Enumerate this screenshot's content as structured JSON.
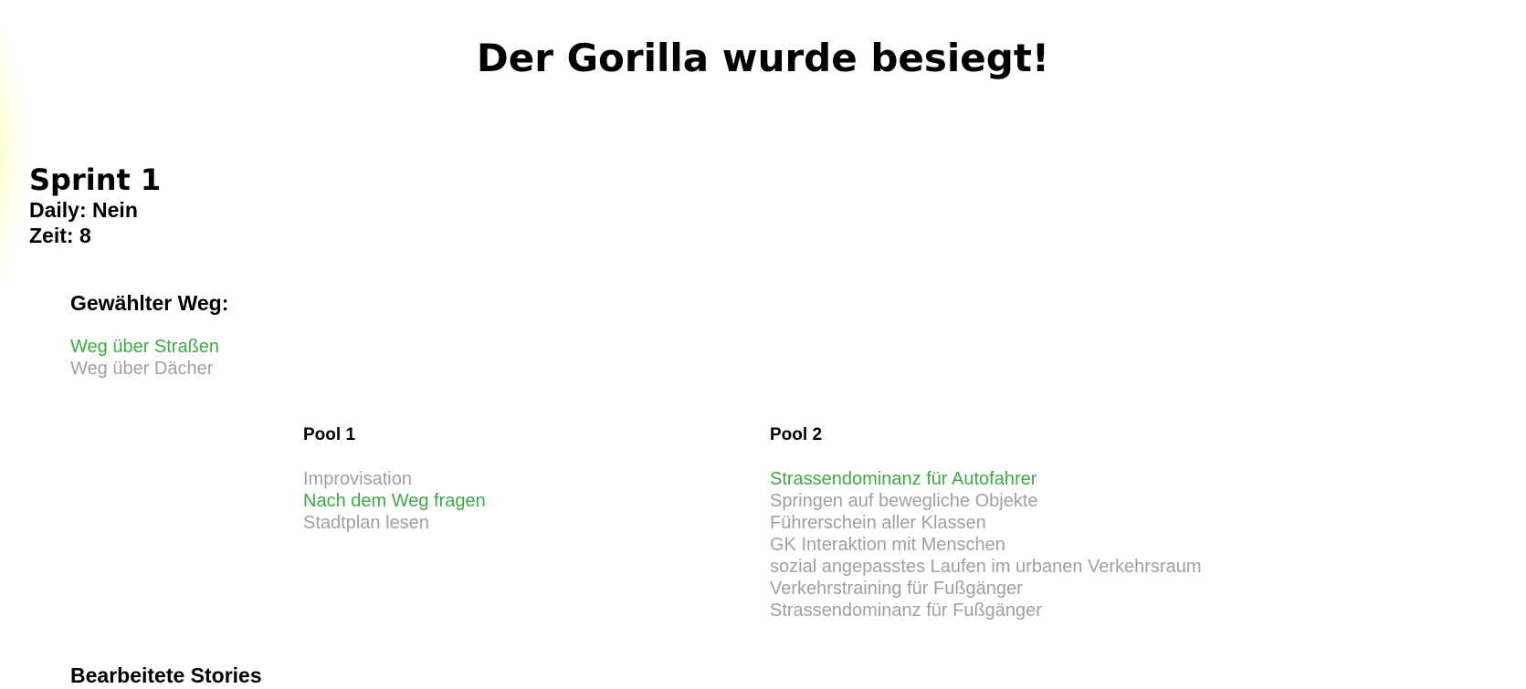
{
  "headline": "Der Gorilla wurde besiegt!",
  "sprint": {
    "title": "Sprint 1",
    "daily": "Daily: Nein",
    "time": "Zeit: 8"
  },
  "path_section": {
    "heading": "Gewählter Weg:",
    "options": [
      {
        "label": "Weg über Straßen",
        "selected": true
      },
      {
        "label": "Weg über Dächer",
        "selected": false
      }
    ]
  },
  "pools": [
    {
      "title": "Pool 1",
      "items": [
        {
          "label": "Improvisation",
          "selected": false
        },
        {
          "label": "Nach dem Weg fragen",
          "selected": true
        },
        {
          "label": "Stadtplan lesen",
          "selected": false
        }
      ]
    },
    {
      "title": "Pool 2",
      "items": [
        {
          "label": "Strassendominanz für Autofahrer",
          "selected": true
        },
        {
          "label": "Springen auf bewegliche Objekte",
          "selected": false
        },
        {
          "label": "Führerschein aller Klassen",
          "selected": false
        },
        {
          "label": "GK Interaktion mit Menschen",
          "selected": false
        },
        {
          "label": "sozial angepasstes Laufen im urbanen Verkehrsraum",
          "selected": false
        },
        {
          "label": "Verkehrstraining für Fußgänger",
          "selected": false
        },
        {
          "label": "Strassendominanz für Fußgänger",
          "selected": false
        }
      ]
    }
  ],
  "stories": {
    "heading": "Bearbeitete Stories"
  },
  "colors": {
    "selected": "#3cab44",
    "unselected": "#a0a0a0"
  }
}
